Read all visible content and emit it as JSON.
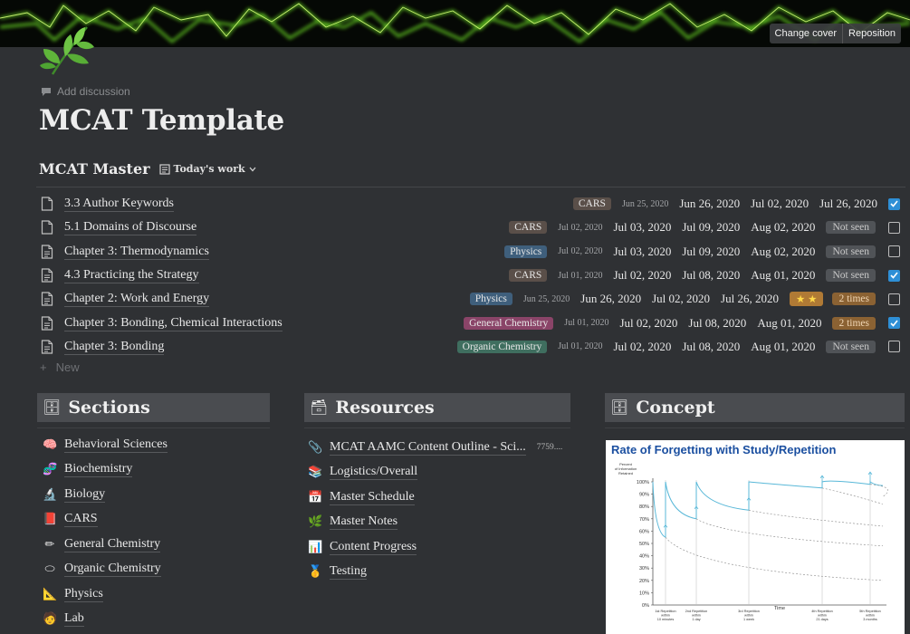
{
  "cover": {
    "change_cover": "Change cover",
    "reposition": "Reposition"
  },
  "page": {
    "add_discussion": "Add discussion",
    "title": "MCAT Template"
  },
  "database": {
    "title": "MCAT Master",
    "view_label": "Today's work",
    "new_label": "New",
    "rows": [
      {
        "title": "3.3 Author Keywords",
        "tag": "CARS",
        "tag_color": "#5a4f49",
        "created": "Jun 25, 2020",
        "d1": "Jun 26, 2020",
        "d2": "Jul 02, 2020",
        "d3": "Jul 26, 2020",
        "status": "",
        "status_color": "",
        "checked": true
      },
      {
        "title": "5.1 Domains of Discourse",
        "tag": "CARS",
        "tag_color": "#5a4f49",
        "created": "Jul 02, 2020",
        "d1": "Jul 03, 2020",
        "d2": "Jul 09, 2020",
        "d3": "Aug 02, 2020",
        "status": "Not seen",
        "status_color": "#505357",
        "checked": false
      },
      {
        "title": "Chapter 3: Thermodynamics",
        "tag": "Physics",
        "tag_color": "#3f5f7c",
        "created": "Jul 02, 2020",
        "d1": "Jul 03, 2020",
        "d2": "Jul 09, 2020",
        "d3": "Aug 02, 2020",
        "status": "Not seen",
        "status_color": "#505357",
        "checked": false
      },
      {
        "title": "4.3 Practicing the Strategy",
        "tag": "CARS",
        "tag_color": "#5a4f49",
        "created": "Jul 01, 2020",
        "d1": "Jul 02, 2020",
        "d2": "Jul 08, 2020",
        "d3": "Aug 01, 2020",
        "status": "Not seen",
        "status_color": "#505357",
        "checked": true
      },
      {
        "title": "Chapter 2: Work and Energy",
        "tag": "Physics",
        "tag_color": "#3f5f7c",
        "created": "Jun 25, 2020",
        "d1": "Jun 26, 2020",
        "d2": "Jul 02, 2020",
        "d3": "Jul 26, 2020",
        "stars": "★ ★",
        "status": "2 times",
        "status_color": "#8b6233",
        "checked": false
      },
      {
        "title": "Chapter 3: Bonding, Chemical Interactions",
        "tag": "General Chemistry",
        "tag_color": "#8a4468",
        "created": "Jul 01, 2020",
        "d1": "Jul 02, 2020",
        "d2": "Jul 08, 2020",
        "d3": "Aug 01, 2020",
        "status": "2 times",
        "status_color": "#8b6233",
        "checked": true
      },
      {
        "title": "Chapter 3: Bonding",
        "tag": "Organic Chemistry",
        "tag_color": "#3f6e5f",
        "created": "Jul 01, 2020",
        "d1": "Jul 02, 2020",
        "d2": "Jul 08, 2020",
        "d3": "Aug 01, 2020",
        "status": "Not seen",
        "status_color": "#505357",
        "checked": false
      }
    ]
  },
  "sections": {
    "heading": "Sections",
    "items": [
      {
        "label": "Behavioral Sciences",
        "icon": "brain-icon",
        "glyph": "🧠"
      },
      {
        "label": "Biochemistry",
        "icon": "dna-icon",
        "glyph": "🧬"
      },
      {
        "label": "Biology",
        "icon": "microscope-icon",
        "glyph": "🔬"
      },
      {
        "label": "CARS",
        "icon": "book-icon",
        "glyph": "📕"
      },
      {
        "label": "General Chemistry",
        "icon": "pencil-icon",
        "glyph": "✏"
      },
      {
        "label": "Organic Chemistry",
        "icon": "dish-icon",
        "glyph": "⬭"
      },
      {
        "label": "Physics",
        "icon": "ruler-icon",
        "glyph": "📐"
      },
      {
        "label": "Lab",
        "icon": "scientist-icon",
        "glyph": "🧑"
      }
    ]
  },
  "resources": {
    "heading": "Resources",
    "items": [
      {
        "label": "MCAT AAMC Content Outline - Sci...",
        "extra": "7759....",
        "icon": "paperclip-icon",
        "glyph": "📎"
      },
      {
        "label": "Logistics/Overall",
        "icon": "books-icon",
        "glyph": "📚"
      },
      {
        "label": "Master Schedule",
        "icon": "calendar-icon",
        "glyph": "📅"
      },
      {
        "label": "Master Notes",
        "icon": "herb-icon",
        "glyph": "🌿"
      },
      {
        "label": "Content Progress",
        "icon": "bar-chart-icon",
        "glyph": "📊"
      },
      {
        "label": "Testing",
        "icon": "medal-icon",
        "glyph": "🥇"
      }
    ]
  },
  "concept": {
    "heading": "Concept",
    "chart_title": "Rate of Forgetting with Study/Repetition",
    "y_axis_label": [
      "Percent",
      "of Information",
      "Retained"
    ],
    "x_axis_label": "Time",
    "y_ticks": [
      "100%",
      "90%",
      "80%",
      "70%",
      "60%",
      "50%",
      "40%",
      "30%",
      "20%",
      "10%",
      "0%"
    ],
    "x_ticks": [
      [
        "1st Repetition",
        "within",
        "10 minutes"
      ],
      [
        "2nd Repetition",
        "within",
        "1 day"
      ],
      [
        "3rd Repetition",
        "within",
        "1 week"
      ],
      [
        "4th Repetition",
        "within",
        "21 days"
      ],
      [
        "5th Repetition",
        "within",
        "3 months"
      ]
    ]
  },
  "chart_data": {
    "type": "line",
    "title": "Rate of Forgetting with Study/Repetition",
    "xlabel": "Time",
    "ylabel": "Percent of Information Retained",
    "ylim": [
      0,
      100
    ],
    "categories": [
      "1st Repetition within 10 minutes",
      "2nd Repetition within 1 day",
      "3rd Repetition within 1 week",
      "4th Repetition within 21 days",
      "5th Repetition within 3 months"
    ],
    "series": [
      {
        "values": [
          55,
          70,
          77,
          95,
          98
        ]
      }
    ]
  }
}
